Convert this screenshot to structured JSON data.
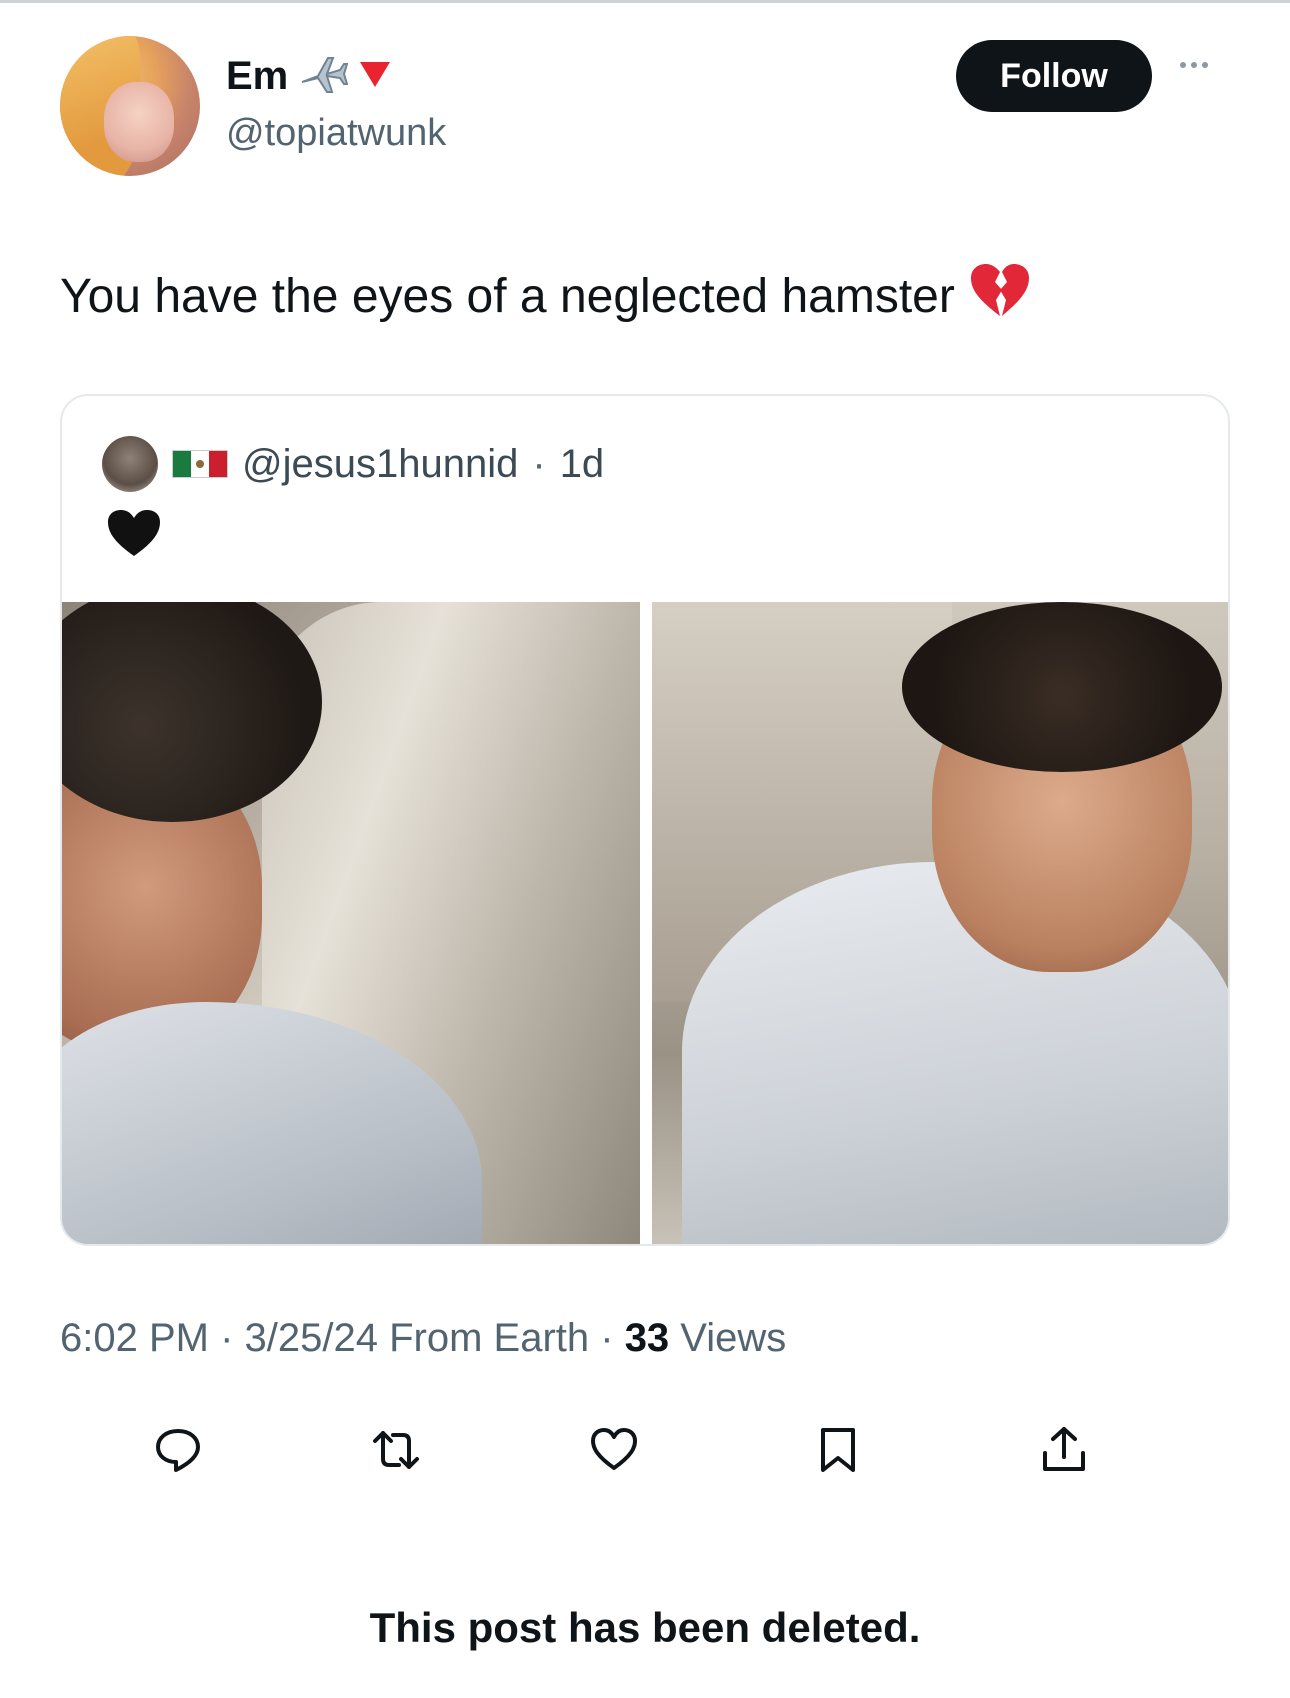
{
  "post": {
    "author_name": "Em",
    "author_handle": "@topiatwunk",
    "follow_label": "Follow",
    "text": "You have the eyes of a neglected hamster",
    "text_emoji": "broken-heart-icon",
    "name_icons": [
      "airplane-icon",
      "red-triangle-icon"
    ]
  },
  "quote": {
    "handle": "@jesus1hunnid",
    "separator": "·",
    "age": "1d",
    "flag": "mexico-flag-icon",
    "body_icon": "black-heart-icon",
    "photos": [
      "selfie-left",
      "selfie-right"
    ]
  },
  "meta": {
    "time": "6:02 PM",
    "sep1": " · ",
    "date": "3/25/24",
    "source": " From Earth",
    "sep2": " · ",
    "views_count": "33",
    "views_label": " Views"
  },
  "actions": [
    "reply-icon",
    "repost-icon",
    "like-icon",
    "bookmark-icon",
    "share-icon"
  ],
  "footer": {
    "deleted_notice": "This post has been deleted."
  },
  "colors": {
    "text": "#0f1419",
    "secondary": "#536471",
    "follow_bg": "#0f1419",
    "border": "#e6e9eb"
  }
}
